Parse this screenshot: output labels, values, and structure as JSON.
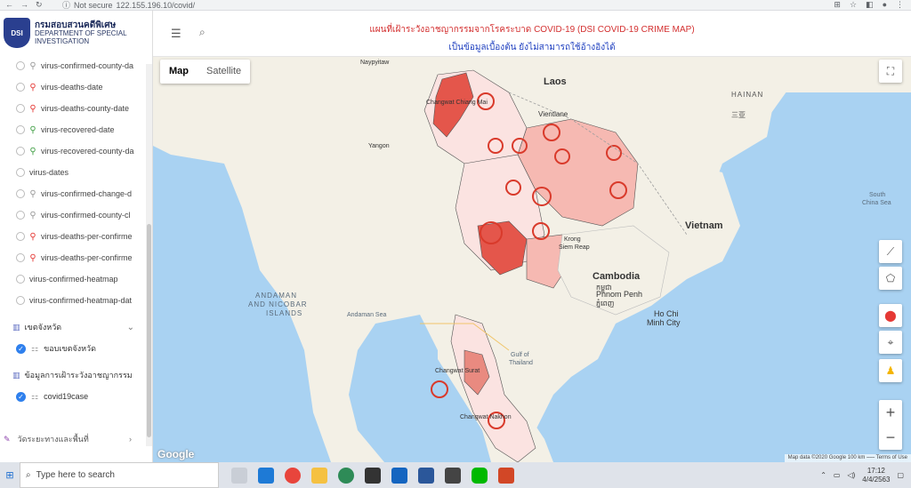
{
  "browser": {
    "not_secure": "Not secure",
    "url": "122.155.196.10/covid/"
  },
  "sidebar": {
    "org_name_thai": "กรมสอบสวนคดีพิเศษ",
    "org_name_en_1": "DEPARTMENT OF SPECIAL",
    "org_name_en_2": "INVESTIGATION",
    "layers": [
      {
        "label": "virus-confirmed-county-da",
        "icon": "gray"
      },
      {
        "label": "virus-deaths-date",
        "icon": "red"
      },
      {
        "label": "virus-deaths-county-date",
        "icon": "red"
      },
      {
        "label": "virus-recovered-date",
        "icon": "green"
      },
      {
        "label": "virus-recovered-county-da",
        "icon": "green"
      },
      {
        "label": "virus-dates",
        "icon": "none"
      },
      {
        "label": "virus-confirmed-change-d",
        "icon": "gray"
      },
      {
        "label": "virus-confirmed-county-cl",
        "icon": "gray"
      },
      {
        "label": "virus-deaths-per-confirme",
        "icon": "red"
      },
      {
        "label": "virus-deaths-per-confirme",
        "icon": "red"
      },
      {
        "label": "virus-confirmed-heatmap",
        "icon": "none"
      },
      {
        "label": "virus-confirmed-heatmap-dat",
        "icon": "none"
      }
    ],
    "groups": [
      {
        "title": "เขตจังหวัด",
        "item": "ขอบเขตจังหวัด"
      },
      {
        "title": "ข้อมูลการเฝ้าระวังอาชญากรรม",
        "item": "covid19case"
      }
    ],
    "footer": "วัดระยะทางและพื้นที่"
  },
  "header": {
    "title": "แผนที่เฝ้าระวังอาชญากรรมจากโรคระบาด COVID-19 (DSI COVID-19 CRIME MAP)",
    "subtitle": "เป็นข้อมูลเบื้องต้น ยังไม่สามารถใช้อ้างอิงได้"
  },
  "map": {
    "type_map": "Map",
    "type_satellite": "Satellite",
    "google": "Google",
    "attribution": "Map data ©2020 Google   100 km ⎯⎯⎯   Terms of Use",
    "labels": {
      "laos": "Laos",
      "vietnam": "Vietnam",
      "cambodia": "Cambodia",
      "cambodia_khmer": "កម្ពុជា",
      "phnom_penh": "Phnom Penh",
      "phnom_penh_khmer": "ភ្នំពេញ",
      "ho_chi_minh": "Ho Chi",
      "ho_chi_minh_2": "Minh City",
      "vientiane": "Vientiane",
      "hainan": "HAINAN",
      "sanya": "三亚",
      "andaman_1": "ANDAMAN",
      "andaman_2": "AND NICOBAR",
      "andaman_3": "ISLANDS",
      "andaman_sea": "Andaman Sea",
      "gulf_1": "Gulf of",
      "gulf_2": "Thailand",
      "naypyitaw": "Naypyitaw",
      "yangon": "Yangon",
      "south_china_sea": "South",
      "south_china_sea_2": "China Sea",
      "siem_reap": "Siem Reap",
      "krong": "Krong",
      "chiang_mai": "Changwat Chiang Mai",
      "surat": "Changwat Surat",
      "nakhon": "Changwat Nakhon"
    }
  },
  "taskbar": {
    "search_placeholder": "Type here to search",
    "time": "17:12",
    "date": "4/4/2563"
  },
  "colors": {
    "title_red": "#d32f2f",
    "subtitle_blue": "#1e3fbf",
    "water": "#a9d2f2",
    "land": "#f3f0e6",
    "province_dark": "#e4564b",
    "province_light": "#fbe3e1"
  }
}
